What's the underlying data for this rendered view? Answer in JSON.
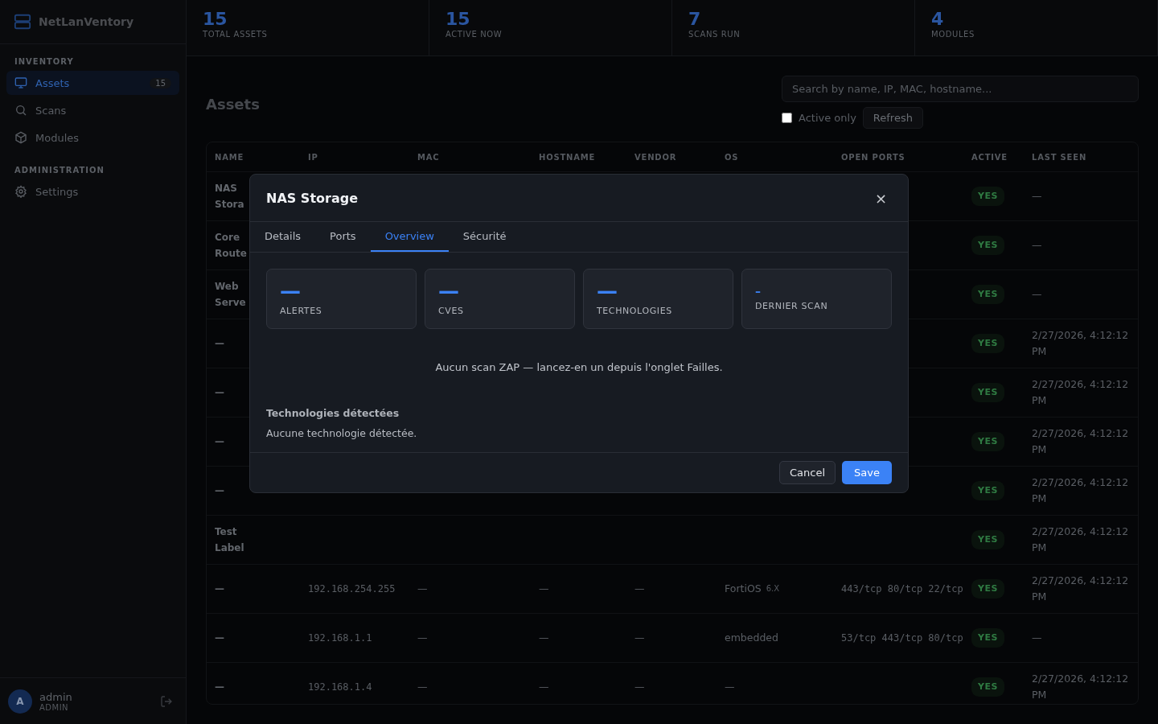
{
  "sidebar": {
    "brand": "NetLanVentory",
    "sections": [
      {
        "title": "INVENTORY",
        "items": [
          {
            "label": "Assets",
            "badge": "15",
            "selected": true
          },
          {
            "label": "Scans",
            "selected": false
          },
          {
            "label": "Modules",
            "selected": false
          }
        ]
      },
      {
        "title": "ADMINISTRATION",
        "items": [
          {
            "label": "Settings",
            "selected": false
          }
        ]
      }
    ],
    "user": {
      "initial": "A",
      "name": "admin",
      "role": "ADMIN"
    }
  },
  "stats": [
    {
      "value": "15",
      "label": "TOTAL ASSETS"
    },
    {
      "value": "15",
      "label": "ACTIVE NOW"
    },
    {
      "value": "7",
      "label": "SCANS RUN"
    },
    {
      "value": "4",
      "label": "MODULES"
    }
  ],
  "page": {
    "title": "Assets",
    "search": {
      "placeholder": "Search by name, IP, MAC, hostname..."
    },
    "active_only": {
      "label": "Active only",
      "checked": false
    },
    "refresh": "Refresh"
  },
  "table": {
    "columns": [
      "NAME",
      "IP",
      "MAC",
      "HOSTNAME",
      "VENDOR",
      "OS",
      "OPEN PORTS",
      "ACTIVE",
      "LAST SEEN"
    ],
    "rows": [
      {
        "name": "NAS Stora",
        "active": "YES",
        "last_seen": "—"
      },
      {
        "name": "Core Route",
        "active": "YES",
        "last_seen": "—"
      },
      {
        "name": "Web Serve",
        "active": "YES",
        "last_seen": "—"
      },
      {
        "name": "—",
        "active": "YES",
        "last_seen": "2/27/2026, 4:12:12 PM"
      },
      {
        "name": "—",
        "active": "YES",
        "last_seen": "2/27/2026, 4:12:12 PM"
      },
      {
        "name": "—",
        "active": "YES",
        "last_seen": "2/27/2026, 4:12:12 PM"
      },
      {
        "name": "—",
        "active": "YES",
        "last_seen": "2/27/2026, 4:12:12 PM"
      },
      {
        "name": "Test Label",
        "active": "YES",
        "last_seen": "2/27/2026, 4:12:12 PM"
      },
      {
        "name": "—",
        "ip": "192.168.254.255",
        "mac": "—",
        "hostname": "—",
        "vendor": "—",
        "os": "FortiOS",
        "os_version": "6.X",
        "ports": "443/tcp 80/tcp 22/tcp",
        "active": "YES",
        "last_seen": "2/27/2026, 4:12:12 PM"
      },
      {
        "name": "—",
        "ip": "192.168.1.1",
        "mac": "—",
        "hostname": "—",
        "vendor": "—",
        "os": "embedded",
        "ports": "53/tcp 443/tcp 80/tcp",
        "active": "YES",
        "last_seen": "—"
      },
      {
        "name": "—",
        "ip": "192.168.1.4",
        "mac": "—",
        "hostname": "—",
        "vendor": "—",
        "os": "—",
        "active": "YES",
        "last_seen": "2/27/2026, 4:12:12 PM"
      }
    ]
  },
  "modal": {
    "title": "NAS Storage",
    "close": "×",
    "tabs": [
      {
        "label": "Details",
        "selected": false
      },
      {
        "label": "Ports",
        "selected": false
      },
      {
        "label": "Overview",
        "selected": true
      },
      {
        "label": "Sécurité",
        "selected": false
      }
    ],
    "cards": [
      {
        "value": "—",
        "label": "ALERTES",
        "small": false
      },
      {
        "value": "—",
        "label": "CVES",
        "small": false
      },
      {
        "value": "—",
        "label": "TECHNOLOGIES",
        "small": false
      },
      {
        "value": "–",
        "label": "DERNIER SCAN",
        "small": true
      }
    ],
    "message": "Aucun scan ZAP — lancez-en un depuis l'onglet Failles.",
    "section_title": "Technologies détectées",
    "section_text": "Aucune technologie détectée.",
    "buttons": [
      {
        "label": "Cancel",
        "kind": "secondary"
      },
      {
        "label": "Save",
        "kind": "primary"
      }
    ]
  }
}
